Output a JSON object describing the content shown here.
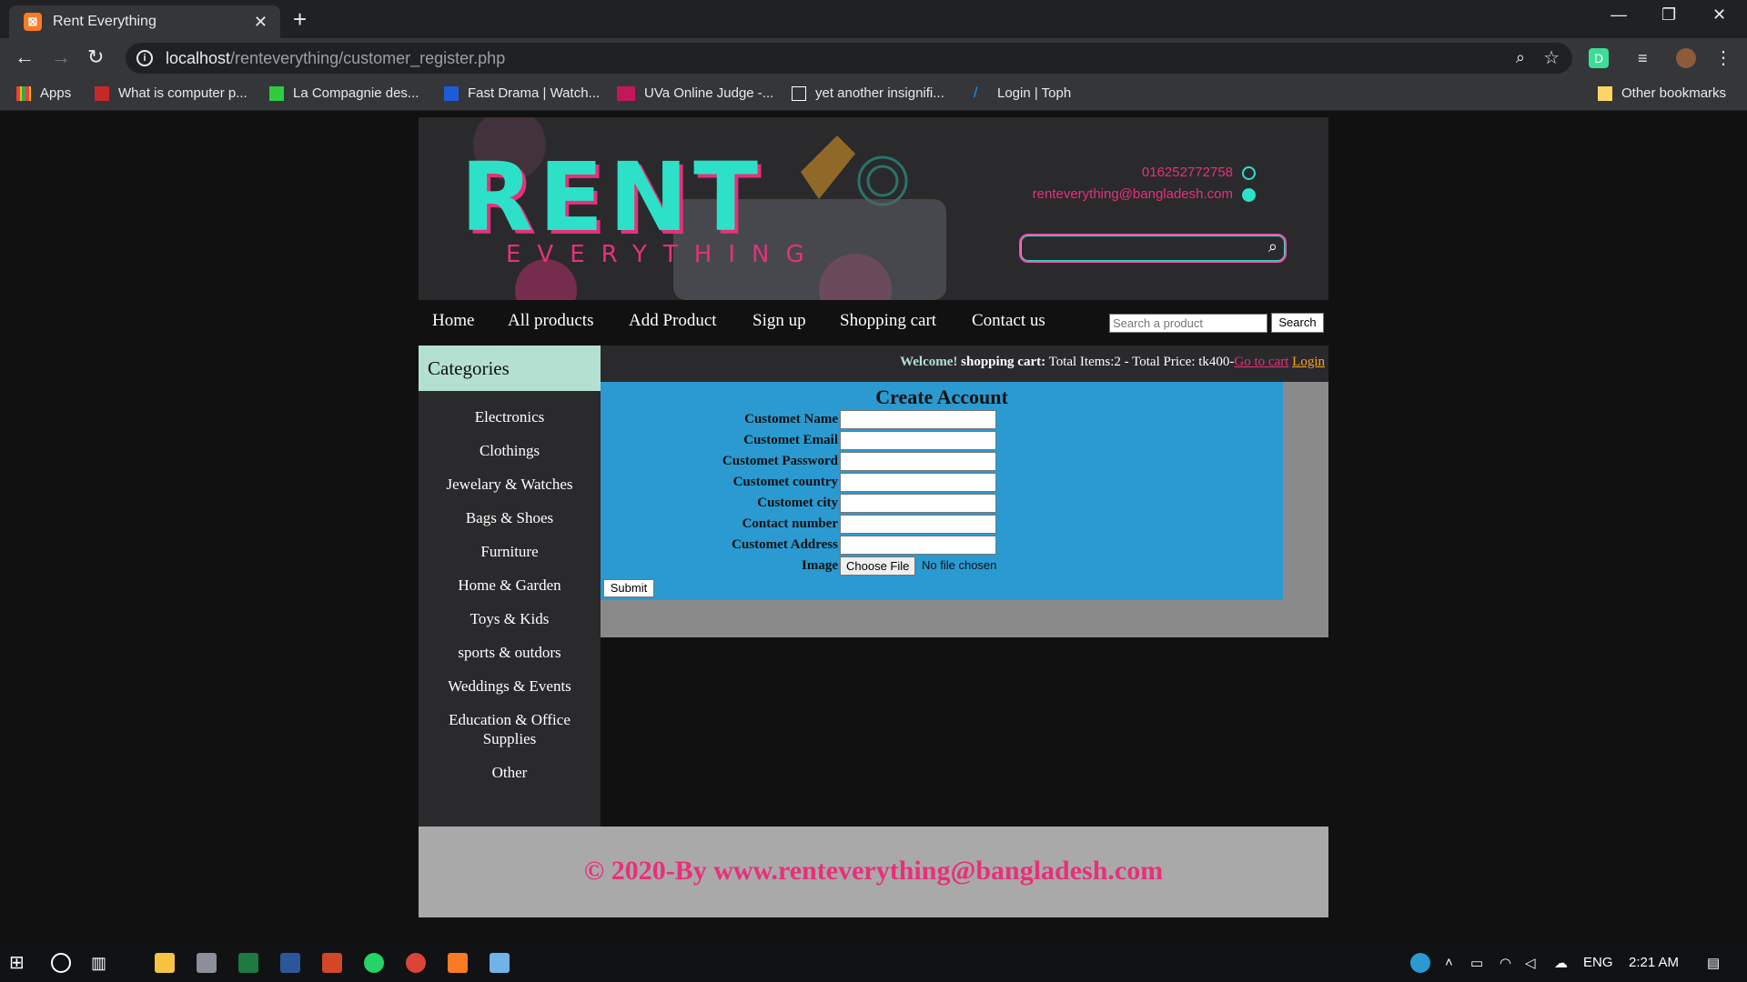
{
  "browser": {
    "tab_title": "Rent Everything",
    "url_host": "localhost",
    "url_path": "/renteverything/customer_register.php",
    "bookmarks": [
      {
        "label": "Apps",
        "color": "#ea4335"
      },
      {
        "label": "What is computer p...",
        "color": "#c62828"
      },
      {
        "label": "La Compagnie des...",
        "color": "#2ecc40"
      },
      {
        "label": "Fast Drama | Watch...",
        "color": "#1e5bd7"
      },
      {
        "label": "UVa Online Judge -...",
        "color": "#c2185b"
      },
      {
        "label": "yet another insignifi...",
        "color": "#ffffff"
      },
      {
        "label": "Login | Toph",
        "color": "#2196f3"
      }
    ],
    "other_bookmarks": "Other bookmarks"
  },
  "header": {
    "logo_main": "RENT",
    "logo_sub": "EVERYTHING",
    "phone": "016252772758",
    "email": "renteverything@bangladesh.com"
  },
  "nav": {
    "items": [
      "Home",
      "All products",
      "Add Product",
      "Sign up",
      "Shopping cart",
      "Contact us"
    ],
    "search_placeholder": "Search a product",
    "search_button": "Search"
  },
  "sidebar": {
    "title": "Categories",
    "items": [
      "Electronics",
      "Clothings",
      "Jewelary & Watches",
      "Bags & Shoes",
      "Furniture",
      "Home & Garden",
      "Toys & Kids",
      "sports & outdors",
      "Weddings & Events",
      "Education & Office Supplies",
      "Other"
    ]
  },
  "welcome": {
    "welcome": "Welcome!",
    "cart_label": "shopping cart:",
    "summary": "Total Items:2 - Total Price: tk400-",
    "go_to_cart": "Go to cart",
    "login": "Login"
  },
  "form": {
    "title": "Create Account",
    "fields": [
      "Customet Name",
      "Customet Email",
      "Customet Password",
      "Customet country",
      "Customet city",
      "Contact number",
      "Customet Address"
    ],
    "image_label": "Image",
    "choose_file": "Choose File",
    "no_file": "No file chosen",
    "submit": "Submit"
  },
  "footer": {
    "text": "© 2020-By www.renteverything@bangladesh.com"
  },
  "taskbar": {
    "lang": "ENG",
    "time": "2:21 AM"
  },
  "colors": {
    "accent_pink": "#e8307a",
    "accent_teal": "#2de1c8",
    "form_blue": "#2a9ad1"
  }
}
